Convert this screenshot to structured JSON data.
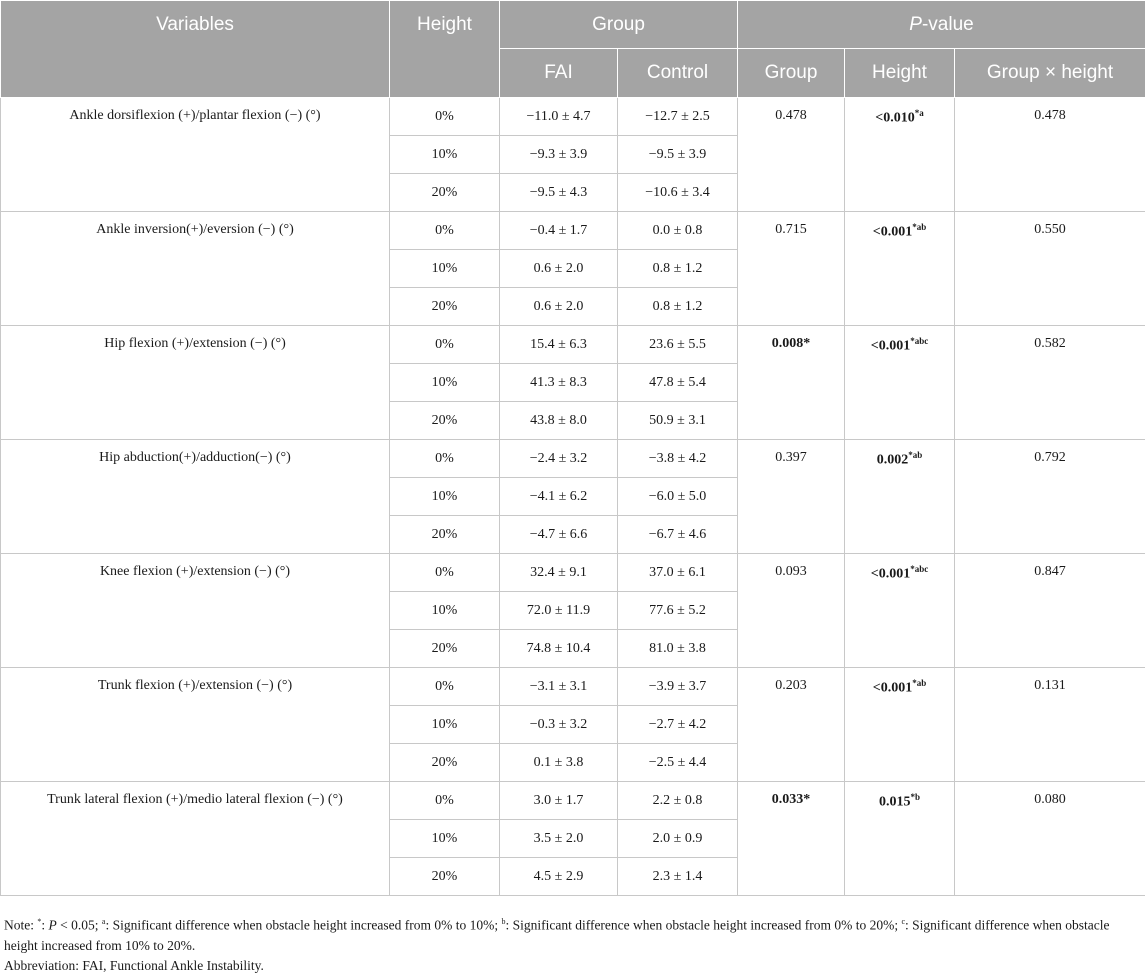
{
  "table": {
    "headers": {
      "variables": "Variables",
      "height": "Height",
      "group": "Group",
      "p_value_italic": "P",
      "p_value_rest": "-value",
      "fai": "FAI",
      "control": "Control",
      "p_group": "Group",
      "p_height": "Height",
      "p_interaction": "Group × height"
    },
    "rows": [
      {
        "variable": "Ankle dorsiflexion (+)/plantar flexion (−) (°)",
        "p_group": "0.478",
        "p_group_bold": false,
        "p_group_sup": "",
        "p_height": "<0.010",
        "p_height_sup": "*a",
        "p_interaction": "0.478",
        "levels": [
          {
            "height": "0%",
            "fai": "−11.0 ± 4.7",
            "control": "−12.7 ± 2.5"
          },
          {
            "height": "10%",
            "fai": "−9.3 ± 3.9",
            "control": "−9.5 ± 3.9"
          },
          {
            "height": "20%",
            "fai": "−9.5 ± 4.3",
            "control": "−10.6 ± 3.4"
          }
        ]
      },
      {
        "variable": "Ankle inversion(+)/eversion (−) (°)",
        "p_group": "0.715",
        "p_group_bold": false,
        "p_group_sup": "",
        "p_height": "<0.001",
        "p_height_sup": "*ab",
        "p_interaction": "0.550",
        "levels": [
          {
            "height": "0%",
            "fai": "−0.4 ± 1.7",
            "control": "0.0 ± 0.8"
          },
          {
            "height": "10%",
            "fai": "0.6 ± 2.0",
            "control": "0.8 ± 1.2"
          },
          {
            "height": "20%",
            "fai": "0.6 ± 2.0",
            "control": "0.8 ± 1.2"
          }
        ]
      },
      {
        "variable": "Hip flexion (+)/extension (−) (°)",
        "p_group": "0.008",
        "p_group_bold": true,
        "p_group_sup": "*",
        "p_height": "<0.001",
        "p_height_sup": "*abc",
        "p_interaction": "0.582",
        "levels": [
          {
            "height": "0%",
            "fai": "15.4 ± 6.3",
            "control": "23.6 ± 5.5"
          },
          {
            "height": "10%",
            "fai": "41.3 ± 8.3",
            "control": "47.8 ± 5.4"
          },
          {
            "height": "20%",
            "fai": "43.8 ± 8.0",
            "control": "50.9 ± 3.1"
          }
        ]
      },
      {
        "variable": "Hip abduction(+)/adduction(−) (°)",
        "p_group": "0.397",
        "p_group_bold": false,
        "p_group_sup": "",
        "p_height": "0.002",
        "p_height_sup": "*ab",
        "p_interaction": "0.792",
        "levels": [
          {
            "height": "0%",
            "fai": "−2.4 ± 3.2",
            "control": "−3.8 ± 4.2"
          },
          {
            "height": "10%",
            "fai": "−4.1 ± 6.2",
            "control": "−6.0 ± 5.0"
          },
          {
            "height": "20%",
            "fai": "−4.7 ± 6.6",
            "control": "−6.7 ± 4.6"
          }
        ]
      },
      {
        "variable": "Knee flexion (+)/extension (−) (°)",
        "p_group": "0.093",
        "p_group_bold": false,
        "p_group_sup": "",
        "p_height": "<0.001",
        "p_height_sup": "*abc",
        "p_interaction": "0.847",
        "levels": [
          {
            "height": "0%",
            "fai": "32.4 ± 9.1",
            "control": "37.0 ± 6.1"
          },
          {
            "height": "10%",
            "fai": "72.0 ± 11.9",
            "control": "77.6 ± 5.2"
          },
          {
            "height": "20%",
            "fai": "74.8 ± 10.4",
            "control": "81.0 ± 3.8"
          }
        ]
      },
      {
        "variable": "Trunk flexion (+)/extension (−) (°)",
        "p_group": "0.203",
        "p_group_bold": false,
        "p_group_sup": "",
        "p_height": "<0.001",
        "p_height_sup": "*ab",
        "p_interaction": "0.131",
        "levels": [
          {
            "height": "0%",
            "fai": "−3.1 ± 3.1",
            "control": "−3.9 ± 3.7"
          },
          {
            "height": "10%",
            "fai": "−0.3 ± 3.2",
            "control": "−2.7 ± 4.2"
          },
          {
            "height": "20%",
            "fai": "0.1 ± 3.8",
            "control": "−2.5 ± 4.4"
          }
        ]
      },
      {
        "variable": "Trunk lateral flexion (+)/medio lateral flexion (−) (°)",
        "p_group": "0.033",
        "p_group_bold": true,
        "p_group_sup": "*",
        "p_height": "0.015",
        "p_height_sup": "*b",
        "p_interaction": "0.080",
        "levels": [
          {
            "height": "0%",
            "fai": "3.0 ± 1.7",
            "control": "2.2 ± 0.8"
          },
          {
            "height": "10%",
            "fai": "3.5 ± 2.0",
            "control": "2.0 ± 0.9"
          },
          {
            "height": "20%",
            "fai": "4.5 ± 2.9",
            "control": "2.3 ± 1.4"
          }
        ]
      }
    ]
  },
  "notes": {
    "note_prefix": "Note: ",
    "ast_sup": "*",
    "ast_text": ": ",
    "ast_p": "P",
    "ast_text2": " < 0.05; ",
    "a_sup": "a",
    "a_text": ": Significant difference when obstacle height increased from 0% to 10%; ",
    "b_sup": "b",
    "b_text": ": Significant difference when obstacle height increased from 0% to 20%; ",
    "c_sup": "c",
    "c_text": ": Significant difference when obstacle height increased from 10% to 20%.",
    "abbreviation": "Abbreviation: FAI, Functional Ankle Instability."
  },
  "colors": {
    "header_bg": "#a4a4a4",
    "header_text": "#ffffff",
    "grid_line": "#c8c8c8"
  }
}
